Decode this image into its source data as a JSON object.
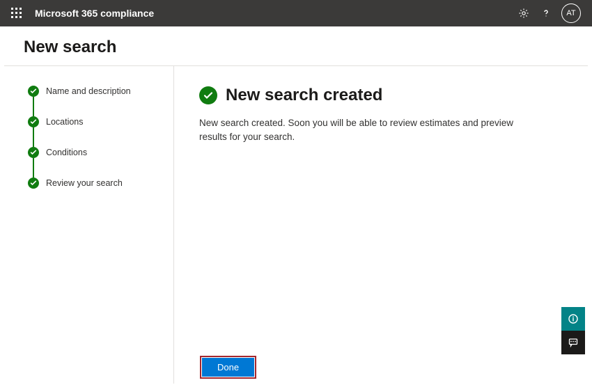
{
  "header": {
    "app_title": "Microsoft 365 compliance",
    "avatar_initials": "AT"
  },
  "page": {
    "title": "New search"
  },
  "stepper": {
    "steps": [
      {
        "label": "Name and description"
      },
      {
        "label": "Locations"
      },
      {
        "label": "Conditions"
      },
      {
        "label": "Review your search"
      }
    ]
  },
  "result": {
    "heading": "New search created",
    "body": "New search created. Soon you will be able to review estimates and preview results for your search."
  },
  "actions": {
    "done_label": "Done"
  }
}
